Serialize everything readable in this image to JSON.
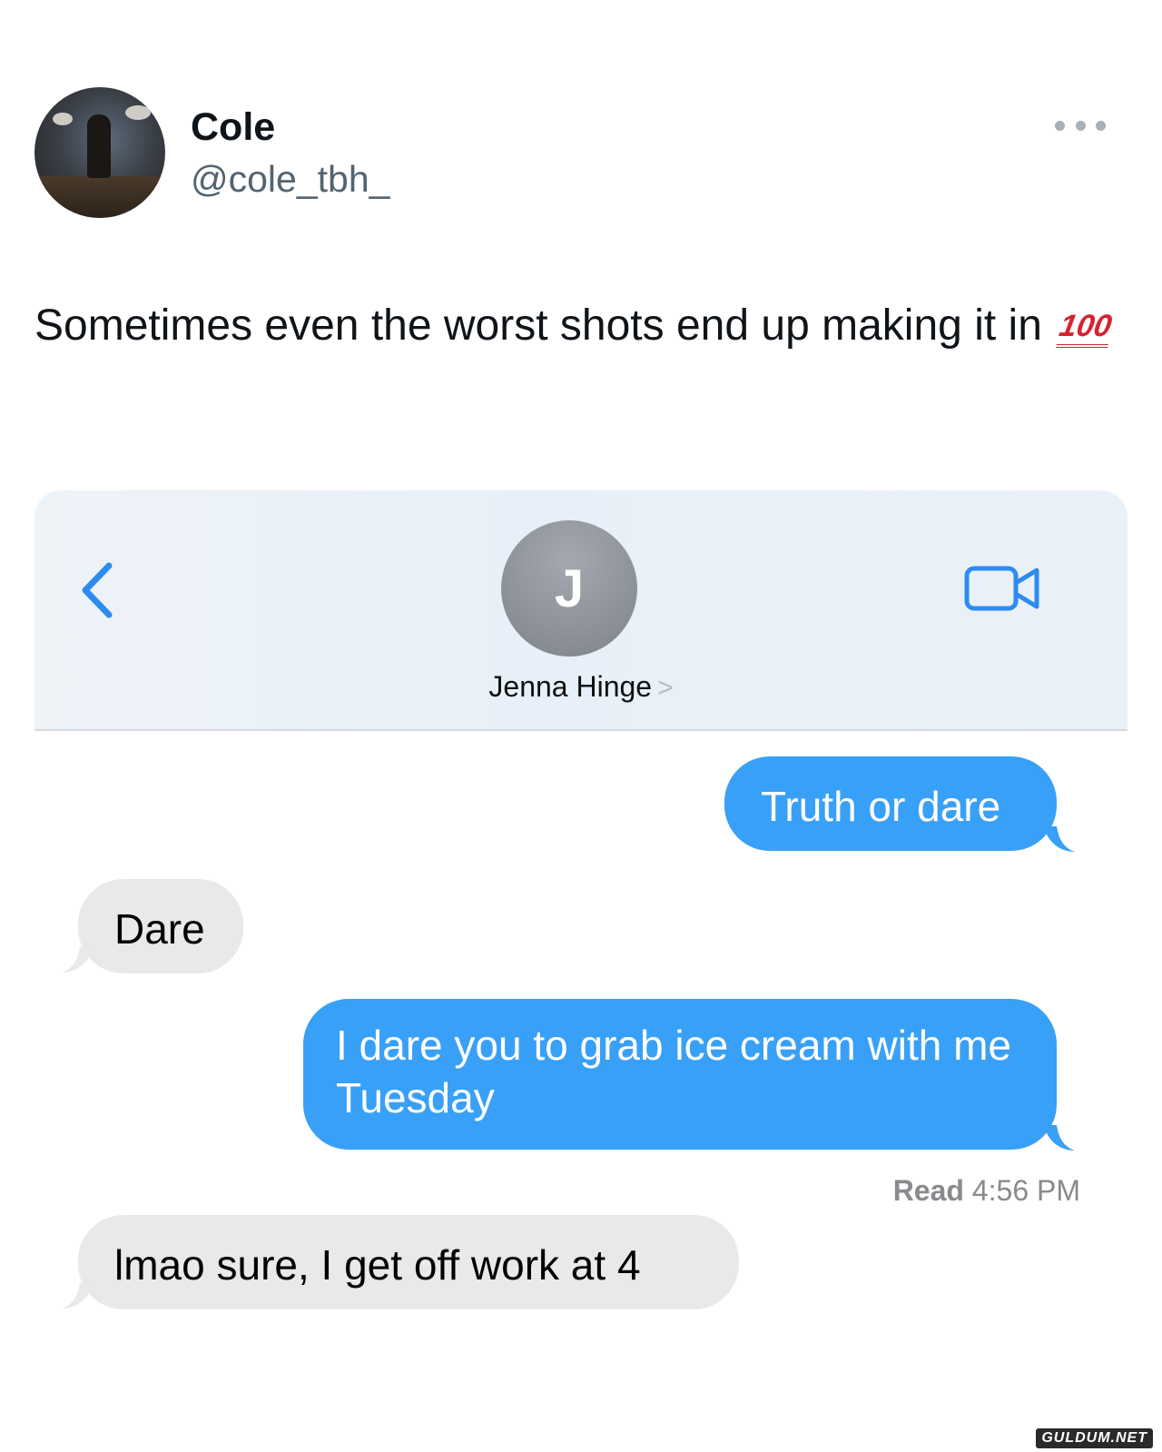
{
  "tweet": {
    "author_name": "Cole",
    "author_handle": "@cole_tbh_",
    "text": "Sometimes even the worst shots end up making it in",
    "emoji": "100",
    "more_icon": "more-horizontal-icon"
  },
  "chat": {
    "contact_initial": "J",
    "contact_name": "Jenna Hinge",
    "contact_chevron": ">",
    "back_icon": "chevron-left-icon",
    "video_icon": "video-camera-icon",
    "accent_color": "#39a0f7",
    "messages": [
      {
        "direction": "sent",
        "text": "Truth or dare"
      },
      {
        "direction": "received",
        "text": "Dare"
      },
      {
        "direction": "sent",
        "text": "I dare you to grab ice cream with me Tuesday"
      },
      {
        "direction": "received",
        "text": "lmao sure, I get off work at 4"
      }
    ],
    "read_label": "Read",
    "read_time": "4:56 PM"
  },
  "watermark": "GULDUM.NET"
}
